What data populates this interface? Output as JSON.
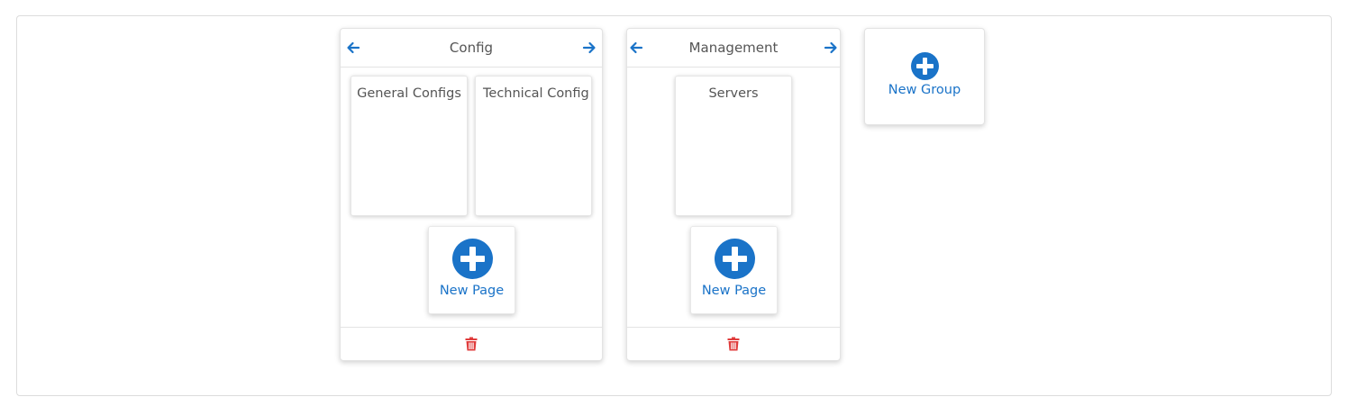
{
  "colors": {
    "accent": "#1a73c8",
    "danger": "#e03c3c",
    "text": "#555555",
    "border": "#e3e3e3"
  },
  "groups": [
    {
      "title": "Config",
      "pages": [
        "General Configs",
        "Technical Config"
      ],
      "new_page_label": "New Page",
      "icons": [
        "arrow-left-icon",
        "arrow-right-icon",
        "plus-circle-icon",
        "trash-icon"
      ]
    },
    {
      "title": "Management",
      "pages": [
        "Servers"
      ],
      "new_page_label": "New Page",
      "icons": [
        "arrow-left-icon",
        "arrow-right-icon",
        "plus-circle-icon",
        "trash-icon"
      ]
    }
  ],
  "new_group": {
    "label": "New Group",
    "icon": "plus-circle-icon"
  }
}
